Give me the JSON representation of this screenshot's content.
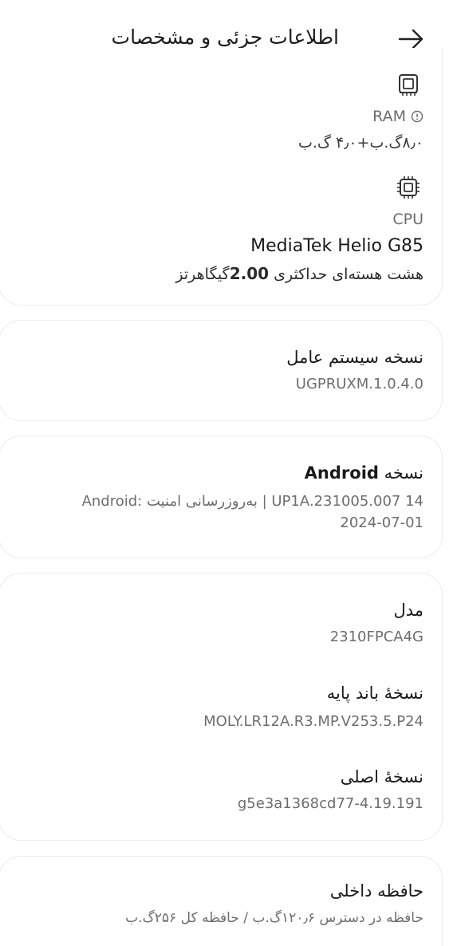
{
  "header": {
    "title": "اطلاعات جزئی و مشخصات",
    "back_icon": "arrow-right-icon"
  },
  "ram": {
    "icon": "memory-chip-icon",
    "label": "RAM",
    "info_icon": "info-circle-icon",
    "value": "۸٫۰گ.ب+۴٫۰ گ.ب"
  },
  "cpu": {
    "icon": "cpu-chip-icon",
    "label": "CPU",
    "name": "MediaTek Helio G85",
    "detail_prefix": "هشت هسته‌ای حداکثری ",
    "detail_speed": "2.00",
    "detail_unit": "گیگاهرتز"
  },
  "os_version": {
    "label": "نسخه سیستم عامل",
    "value": "UGPRUXM.1.0.4.0"
  },
  "android_version": {
    "label_prefix": "نسخه ",
    "label_bold": "Android",
    "line1": "Android: بەروزرسانی امنیت | UP1A.231005.007 14",
    "line2": "2024-07-01"
  },
  "device": {
    "model_label": "مدل",
    "model_value": "2310FPCA4G",
    "baseband_label": "نسخهٔ باند پایه",
    "baseband_value": "MOLY.LR12A.R3.MP.V253.5.P24",
    "kernel_label": "نسخهٔ اصلی",
    "kernel_value": "g5e3a1368cd77-4.19.191"
  },
  "storage": {
    "label": "حافظه داخلی",
    "value": "حافظه در دسترس ۱۲۰٫۶گ.ب / حافظه کل ۲۵۶گ.ب"
  },
  "colors": {
    "background": "#ffffff",
    "card_border": "#ececec",
    "primary_text": "#1a1a1a",
    "secondary_text": "#6d6d6d"
  }
}
